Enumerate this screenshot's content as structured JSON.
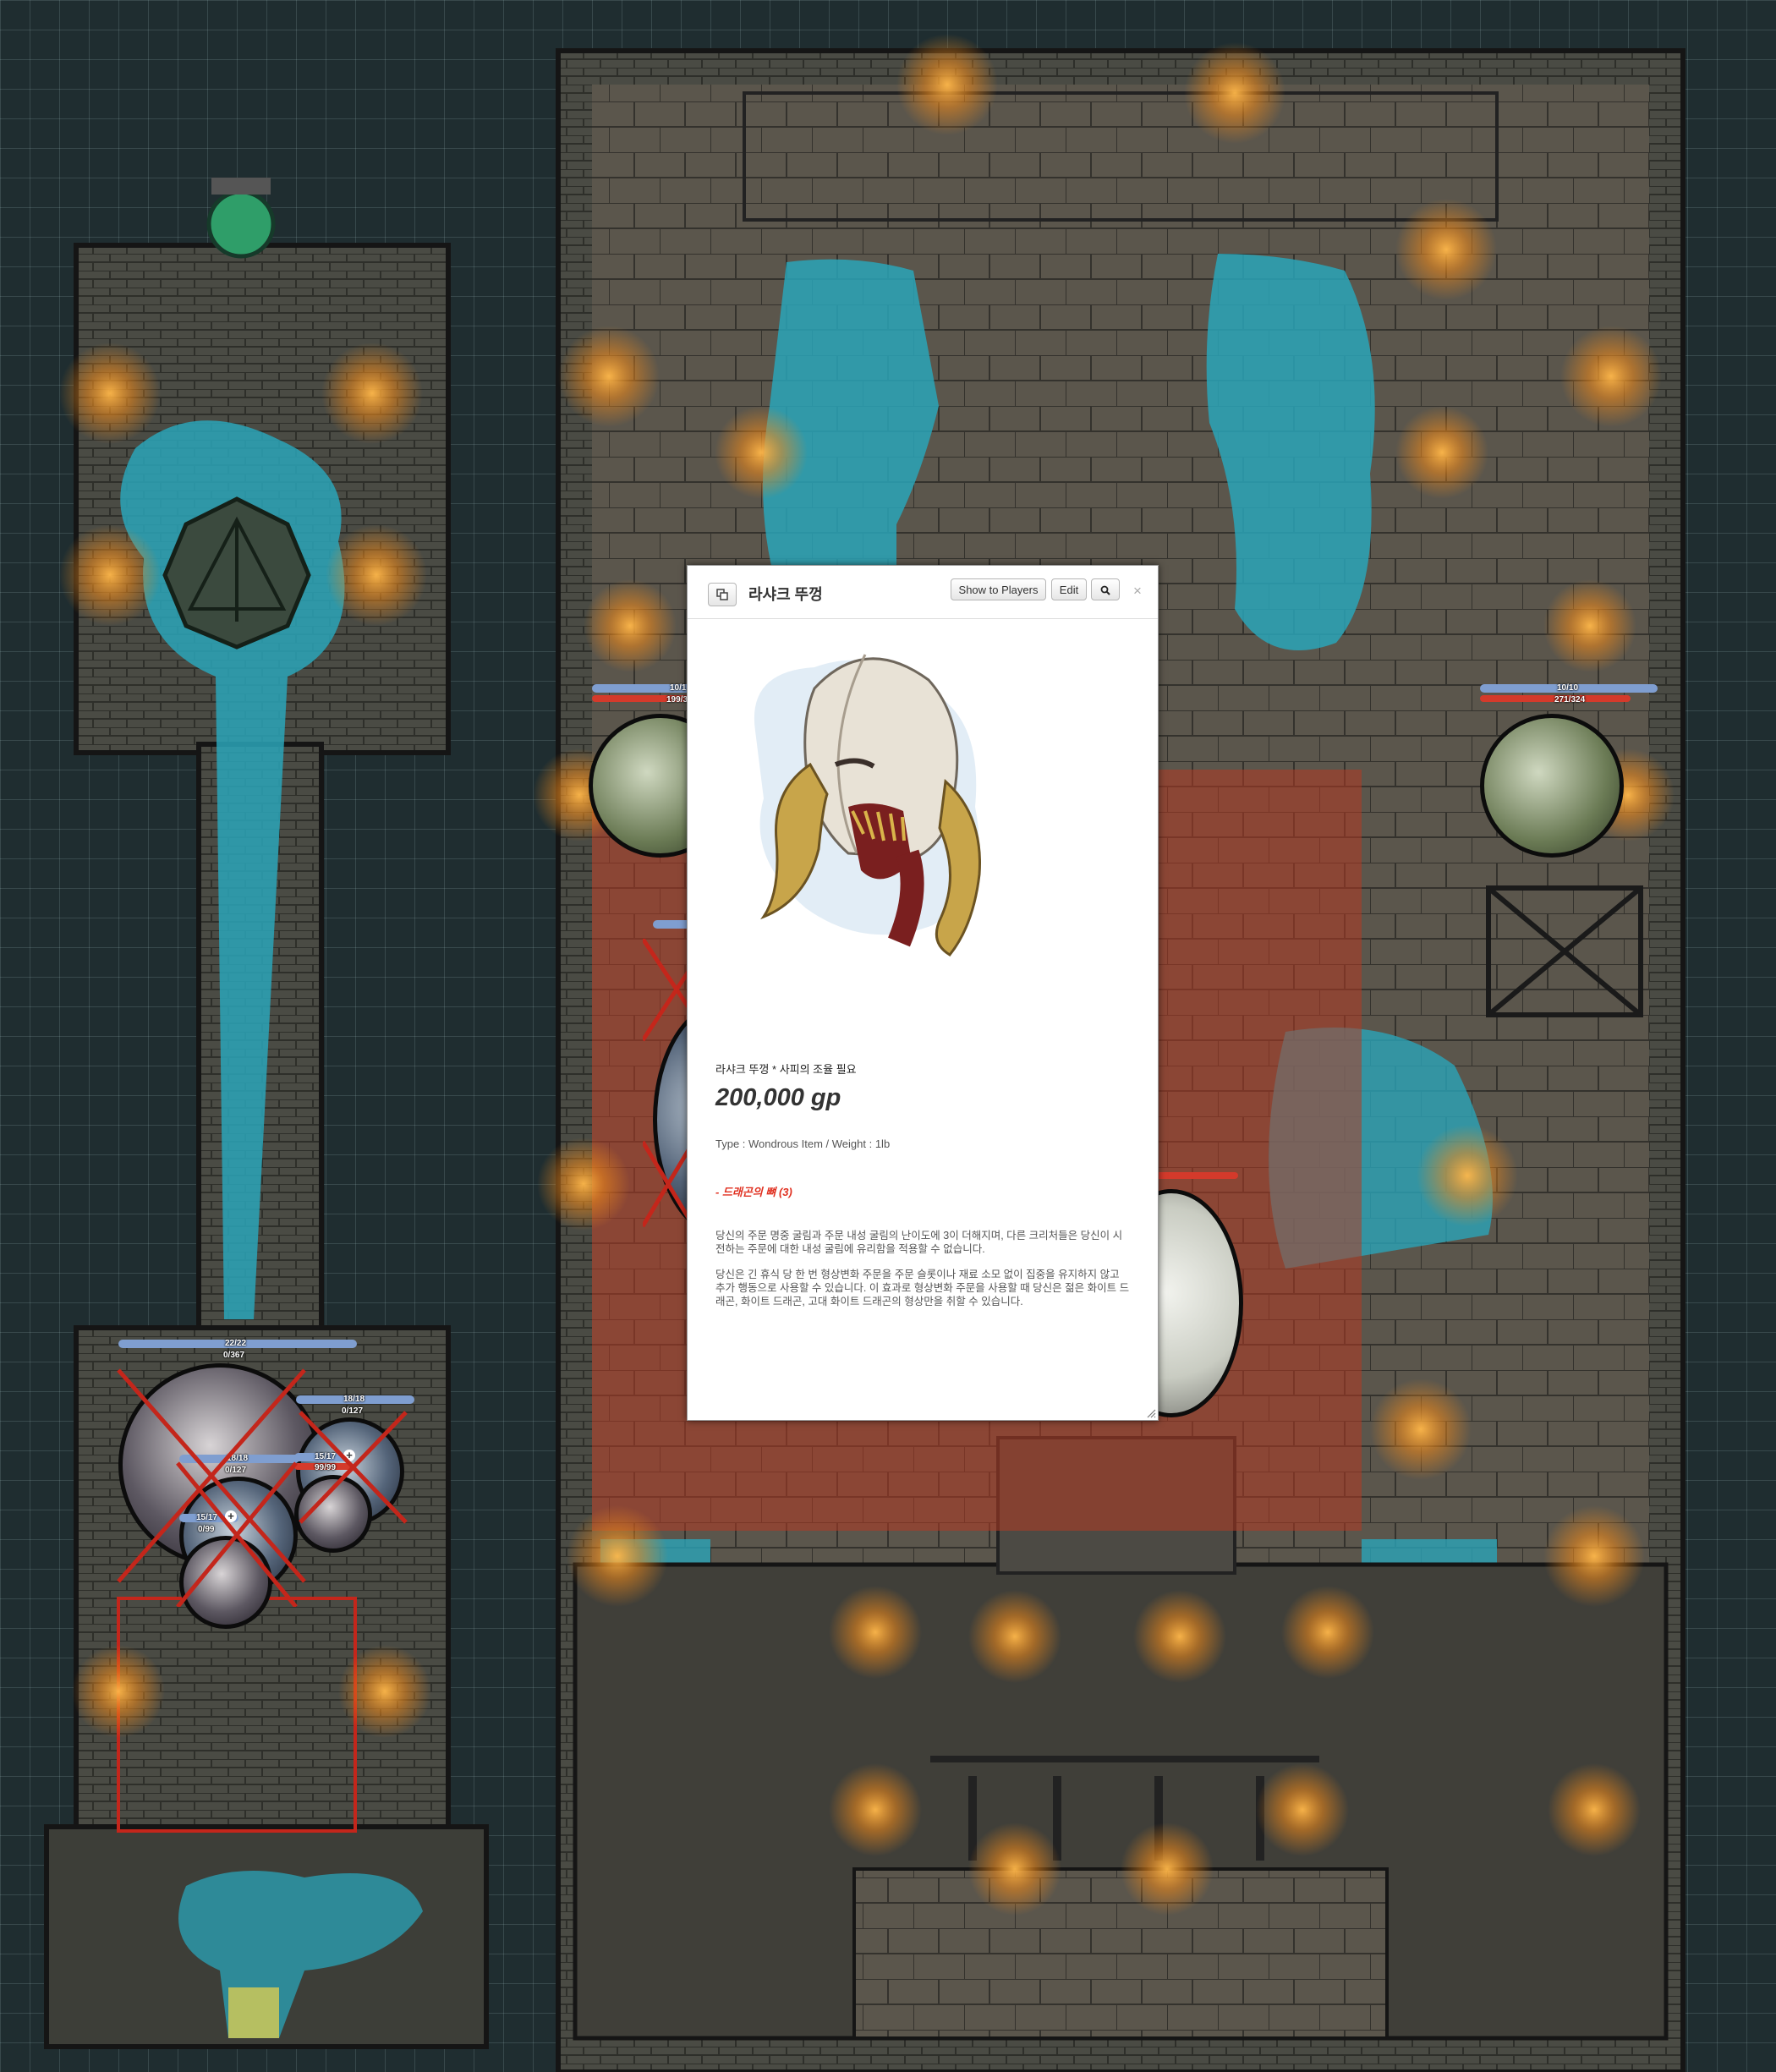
{
  "map": {
    "tokens": [
      {
        "name": "token-dragon-left",
        "bars": [
          "10/1",
          "199/3"
        ]
      },
      {
        "name": "token-dragon-right",
        "bars": [
          "10/10",
          "271/324"
        ]
      },
      {
        "name": "token-big-dark",
        "bars": [
          "22/22",
          "0/367"
        ]
      },
      {
        "name": "token-small-1",
        "bars": [
          "18/18",
          "0/127"
        ]
      },
      {
        "name": "token-small-2",
        "bars": [
          "18/18",
          "0/127"
        ]
      },
      {
        "name": "token-small-3",
        "bars": [
          "15/17",
          "99/99"
        ]
      },
      {
        "name": "token-small-4",
        "bars": [
          "15/17",
          "0/99"
        ]
      }
    ]
  },
  "dialog": {
    "title": "라샤크 뚜껑",
    "buttons": {
      "show_players": "Show to Players",
      "edit": "Edit",
      "close": "×"
    },
    "icons": {
      "popout": "popout-icon",
      "search": "magnifier-icon"
    },
    "item": {
      "name_line": "라샤크 뚜껑 * 사피의 조율 필요",
      "price": "200,000 gp",
      "type_line": "Type : Wondrous Item / Weight : 1lb",
      "feature": "- 드래곤의 뼈 (3)",
      "description_1": "당신의 주문 명중 굴림과 주문 내성 굴림의 난이도에 3이 더해지며, 다른 크리처들은 당신이 시전하는 주문에 대한 내성 굴림에 유리함을 적용할 수 없습니다.",
      "description_2": "당신은 긴 휴식 당 한 번 형상변화 주문을 주문 슬롯이나 재료 소모 없이 집중을 유지하지 않고 추가 행동으로 사용할 수 있습니다. 이 효과로 형상변화 주문을 사용할 때 당신은 젊은 화이트 드래곤, 화이트 드래곤, 고대 화이트 드래곤의 형상만을 취할 수 있습니다."
    }
  },
  "colors": {
    "grid_bg": "#1f2d30",
    "water": "#2aa4b8",
    "torch": "#f39a1f",
    "danger_zone": "#b33a22",
    "hp_bar": "#7f9ed0",
    "secondary_bar": "#d43a2b",
    "feature_red": "#e03020"
  }
}
